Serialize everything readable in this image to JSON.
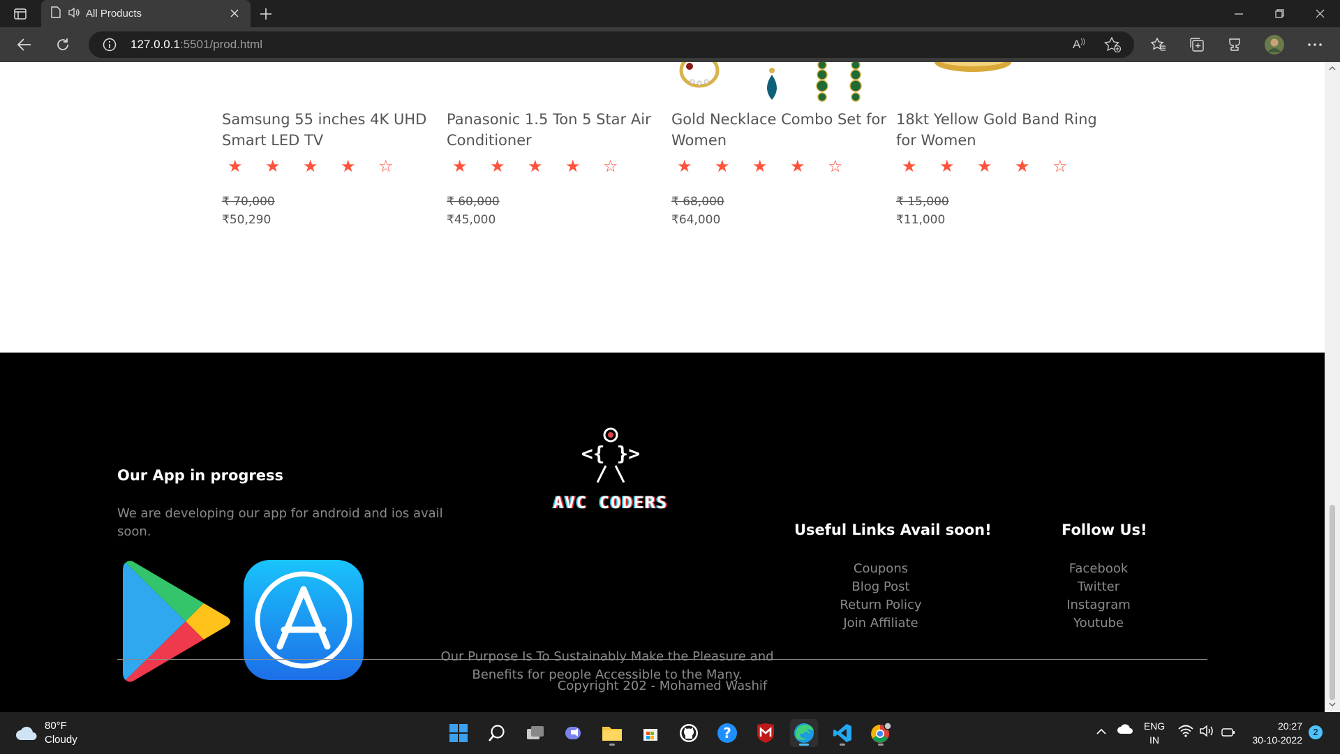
{
  "browser": {
    "tab_title": "All Products",
    "url_host": "127.0.0.1",
    "url_path": ":5501/prod.html"
  },
  "products": [
    {
      "name": "Samsung 55 inches 4K UHD Smart LED TV",
      "rating": 4,
      "old_price": "₹ 70,000 ",
      "price": "₹50,290"
    },
    {
      "name": "Panasonic 1.5 Ton 5 Star Air Conditioner",
      "rating": 4,
      "old_price": "₹ 60,000 ",
      "price": "₹45,000"
    },
    {
      "name": "Gold Necklace Combo Set for Women",
      "rating": 4,
      "old_price": "₹ 68,000 ",
      "price": "₹64,000"
    },
    {
      "name": "18kt Yellow Gold Band Ring for Women",
      "rating": 4,
      "old_price": "₹ 15,000 ",
      "price": "₹11,000"
    }
  ],
  "footer": {
    "app_title": "Our App in progress",
    "app_text": "We are developing our app for android and ios avail soon.",
    "logo_text": "AVC CODERS",
    "purpose": "Our Purpose Is To Sustainably Make the Pleasure and Benefits for people Accessible to the Many.",
    "useful_title": "Useful Links Avail soon!",
    "useful_links": [
      "Coupons",
      "Blog Post",
      "Return Policy",
      "Join Affiliate"
    ],
    "follow_title": "Follow Us!",
    "follow_links": [
      "Facebook",
      "Twitter",
      "Instagram",
      "Youtube"
    ],
    "copyright": "Copyright 202 - Mohamed Washif"
  },
  "taskbar": {
    "temperature": "80°F",
    "condition": "Cloudy",
    "lang": "ENG",
    "region": "IN",
    "time": "20:27",
    "date": "30-10-2022",
    "notifications": "2"
  },
  "colors": {
    "star": "#ff523b",
    "footer_bg": "#000000",
    "chrome_dark": "#202020",
    "chrome_mid": "#3b3b3b"
  }
}
